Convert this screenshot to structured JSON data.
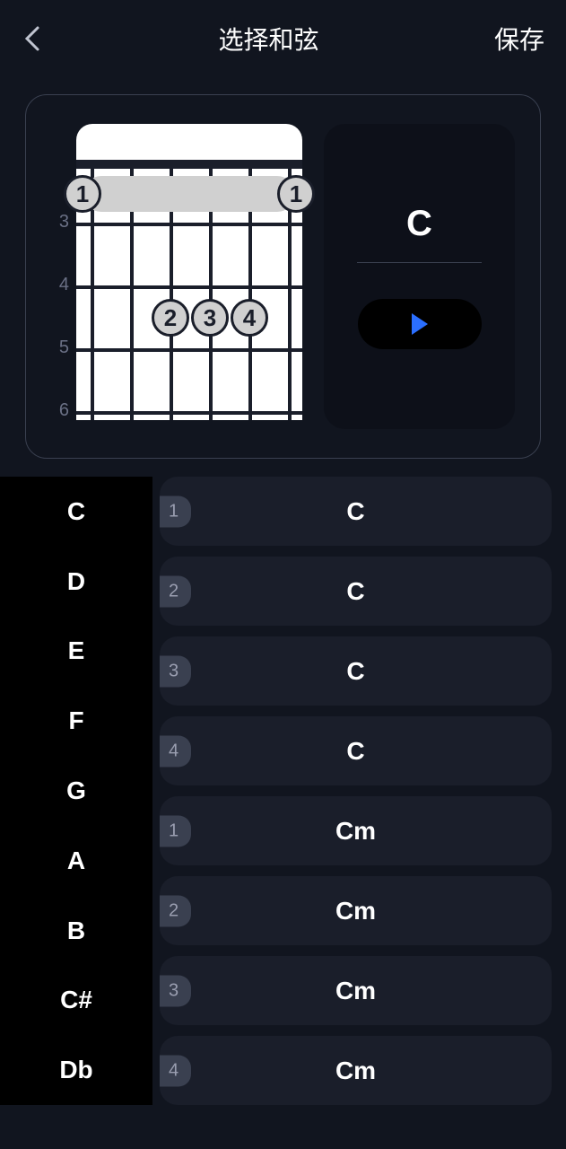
{
  "header": {
    "title": "选择和弦",
    "save_label": "保存"
  },
  "chord": {
    "name": "C",
    "fret_numbers": [
      "3",
      "4",
      "5",
      "6"
    ],
    "barre_fingers": {
      "left": "1",
      "right": "1"
    },
    "fingers": [
      {
        "label": "2"
      },
      {
        "label": "3"
      },
      {
        "label": "4"
      }
    ]
  },
  "roots": [
    "C",
    "D",
    "E",
    "F",
    "G",
    "A",
    "B",
    "C#",
    "Db"
  ],
  "variants": [
    {
      "badge": "1",
      "label": "C"
    },
    {
      "badge": "2",
      "label": "C"
    },
    {
      "badge": "3",
      "label": "C"
    },
    {
      "badge": "4",
      "label": "C"
    },
    {
      "badge": "1",
      "label": "Cm"
    },
    {
      "badge": "2",
      "label": "Cm"
    },
    {
      "badge": "3",
      "label": "Cm"
    },
    {
      "badge": "4",
      "label": "Cm"
    }
  ]
}
